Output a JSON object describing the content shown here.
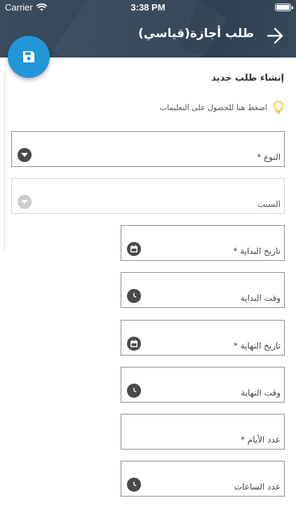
{
  "status_bar": {
    "carrier": "Carrier",
    "time": "3:38 PM"
  },
  "header": {
    "title": "طلب أجازة(قياسي)"
  },
  "form": {
    "section_title": "إنشاء طلب جديد",
    "hint": "اضغط هنا للحصول على التعليمات",
    "fields": {
      "type": "النوع *",
      "reason": "السبب",
      "start_date": "تاريخ البداية *",
      "start_time": "وقت البداية",
      "end_date": "تاريخ النهاية *",
      "end_time": "وقت النهاية",
      "days_count": "عدد الأيام *",
      "hours_count": "عدد الساعات"
    }
  },
  "colors": {
    "header": "#34465a",
    "fab": "#2196d8",
    "hint_bulb": "#e8c520"
  }
}
